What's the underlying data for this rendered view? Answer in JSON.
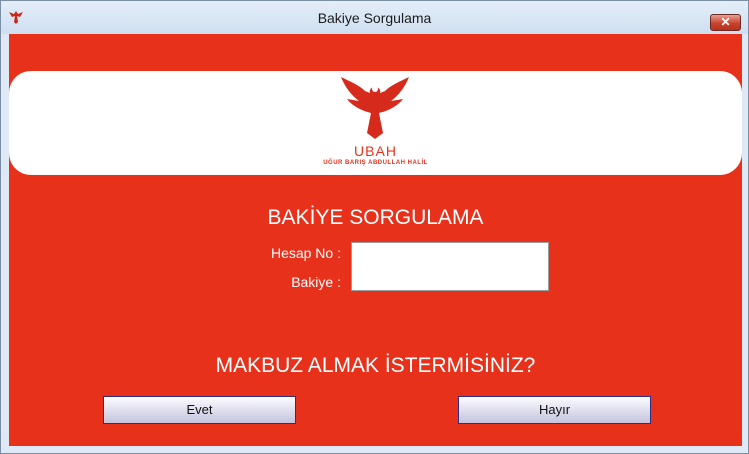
{
  "window": {
    "title": "Bakiye Sorgulama",
    "close_symbol": "✕",
    "logo_icon": "ubah-logo-icon"
  },
  "banner": {
    "logo_icon": "eagle-icon",
    "brand_name": "UBAH",
    "brand_subtitle": "UĞUR BARIŞ ABDULLAH HALİL",
    "brand_color": "#e8311b"
  },
  "form": {
    "heading": "BAKİYE SORGULAMA",
    "account_label": "Hesap No :",
    "balance_label": "Bakiye :",
    "field_value": ""
  },
  "receipt": {
    "question": "MAKBUZ ALMAK İSTERMİSİNİZ?",
    "yes_label": "Evet",
    "no_label": "Hayır"
  },
  "colors": {
    "panel_background": "#e8311b",
    "button_border": "#2b2f8a"
  }
}
